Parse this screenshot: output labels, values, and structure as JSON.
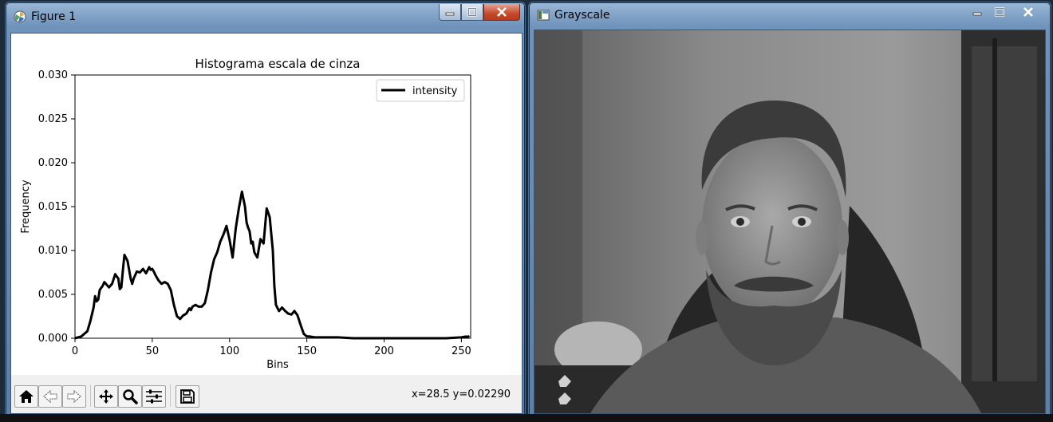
{
  "figure_window": {
    "title": "Figure 1",
    "coords_readout": "x=28.5 y=0.02290",
    "toolbar": {
      "home": "home-icon",
      "back": "back-arrow-icon",
      "forward": "forward-arrow-icon",
      "pan": "pan-icon",
      "zoom": "zoom-icon",
      "configure": "configure-subplots-icon",
      "save": "save-icon"
    }
  },
  "grayscale_window": {
    "title": "Grayscale"
  },
  "chart_data": {
    "type": "line",
    "title": "Histograma escala de cinza",
    "xlabel": "Bins",
    "ylabel": "Frequency",
    "xlim": [
      0,
      256
    ],
    "ylim": [
      0,
      0.03
    ],
    "xticks": [
      "0",
      "50",
      "100",
      "150",
      "200",
      "250"
    ],
    "yticks": [
      "0.000",
      "0.005",
      "0.010",
      "0.015",
      "0.020",
      "0.025",
      "0.030"
    ],
    "legend": "top-right",
    "grid": false,
    "series": [
      {
        "name": "intensity",
        "color": "#000000",
        "x": [
          0,
          4,
          8,
          10,
          12,
          13,
          14,
          15,
          16,
          18,
          19,
          20,
          22,
          24,
          26,
          28,
          29,
          30,
          31,
          32,
          34,
          36,
          37,
          38,
          40,
          42,
          44,
          46,
          48,
          49,
          50,
          51,
          52,
          54,
          56,
          58,
          60,
          62,
          64,
          66,
          68,
          70,
          72,
          74,
          75,
          76,
          78,
          80,
          82,
          84,
          86,
          88,
          90,
          92,
          94,
          96,
          98,
          100,
          102,
          104,
          106,
          108,
          110,
          111,
          112,
          113,
          114,
          115,
          116,
          118,
          120,
          122,
          124,
          126,
          128,
          129,
          130,
          132,
          134,
          136,
          138,
          140,
          142,
          144,
          146,
          148,
          150,
          152,
          155,
          160,
          170,
          180,
          190,
          200,
          210,
          220,
          230,
          240,
          250,
          253,
          254,
          255
        ],
        "y": [
          0.0,
          0.0002,
          0.0008,
          0.002,
          0.0035,
          0.0048,
          0.0042,
          0.0044,
          0.0055,
          0.006,
          0.0064,
          0.0062,
          0.0058,
          0.0062,
          0.0073,
          0.0068,
          0.0056,
          0.0058,
          0.0078,
          0.0095,
          0.0088,
          0.0068,
          0.0062,
          0.0068,
          0.0076,
          0.0075,
          0.0079,
          0.0074,
          0.0081,
          0.0078,
          0.0079,
          0.0076,
          0.0072,
          0.0066,
          0.0062,
          0.0064,
          0.0062,
          0.0055,
          0.0038,
          0.0025,
          0.0022,
          0.0026,
          0.0028,
          0.0034,
          0.0032,
          0.0036,
          0.0038,
          0.0036,
          0.0036,
          0.004,
          0.0055,
          0.0075,
          0.009,
          0.0098,
          0.011,
          0.0118,
          0.0128,
          0.0112,
          0.0092,
          0.0125,
          0.0148,
          0.0167,
          0.015,
          0.0132,
          0.0126,
          0.0122,
          0.0108,
          0.011,
          0.0098,
          0.0092,
          0.0113,
          0.0108,
          0.0148,
          0.0138,
          0.01,
          0.006,
          0.0038,
          0.0031,
          0.0035,
          0.0031,
          0.0028,
          0.0027,
          0.0031,
          0.0026,
          0.0015,
          0.0005,
          0.0002,
          0.0002,
          0.0001,
          0.0001,
          0.0001,
          0.0,
          0.0,
          0.0,
          0.0,
          0.0,
          0.0,
          0.0,
          0.0001,
          0.0002,
          0.0001,
          0.0003
        ]
      }
    ]
  }
}
